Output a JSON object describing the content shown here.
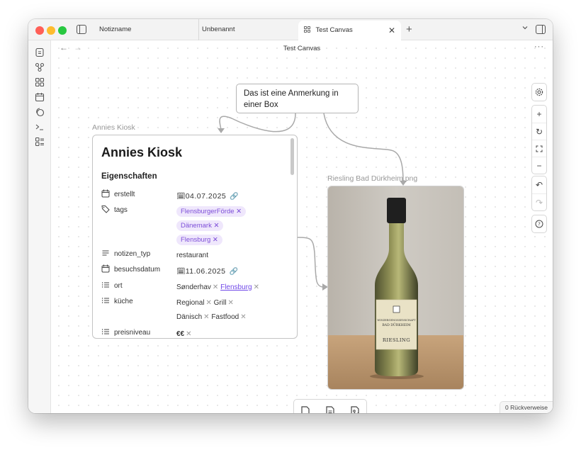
{
  "window": {
    "tabs": [
      {
        "label": "Notizname"
      },
      {
        "label": "Unbenannt"
      },
      {
        "label": "Test Canvas",
        "active": true
      }
    ]
  },
  "view": {
    "title": "Test Canvas"
  },
  "canvas": {
    "annotation_text": "Das ist eine Anmerkung in einer Box",
    "note_node": {
      "label": "Annies Kiosk",
      "title": "Annies Kiosk",
      "properties_heading": "Eigenschaften",
      "properties": {
        "erstellt": {
          "key": "erstellt",
          "value": "04.07.2025"
        },
        "tags": {
          "key": "tags",
          "values": [
            "FlensburgerFörde",
            "Dänemark",
            "Flensburg"
          ]
        },
        "notizen_typ": {
          "key": "notizen_typ",
          "value": "restaurant"
        },
        "besuchsdatum": {
          "key": "besuchsdatum",
          "value": "11.06.2025"
        },
        "ort": {
          "key": "ort",
          "values": [
            "Sønderhav",
            "Flensburg"
          ]
        },
        "kueche": {
          "key": "küche",
          "values": [
            "Regional",
            "Grill",
            "Dänisch",
            "Fastfood"
          ]
        },
        "preisniveau": {
          "key": "preisniveau",
          "value": "€€"
        }
      }
    },
    "image_node": {
      "label": "Riesling Bad Dürkheim.png",
      "bottle_label": {
        "line1": "WINZERGENOSSENSCHAFT",
        "line2": "BAD DÜRKHEIM",
        "line3": "RIESLING"
      }
    }
  },
  "status_bar": {
    "backlinks": "0 Rückverweise"
  },
  "icons": {
    "ribbon": [
      "file-icon",
      "graph-icon",
      "canvas-icon",
      "calendar-icon",
      "copy-icon",
      "terminal-icon",
      "bases-icon"
    ],
    "controls": [
      "settings-icon",
      "zoom-in-icon",
      "reset-zoom-icon",
      "fit-icon",
      "zoom-out-icon",
      "undo-icon",
      "redo-icon",
      "help-icon"
    ],
    "add_bar": [
      "new-card-icon",
      "add-note-icon",
      "add-media-icon"
    ]
  },
  "colors": {
    "tag_bg": "#efe7fc",
    "tag_text": "#7d4ed8",
    "link": "#7048e8"
  }
}
